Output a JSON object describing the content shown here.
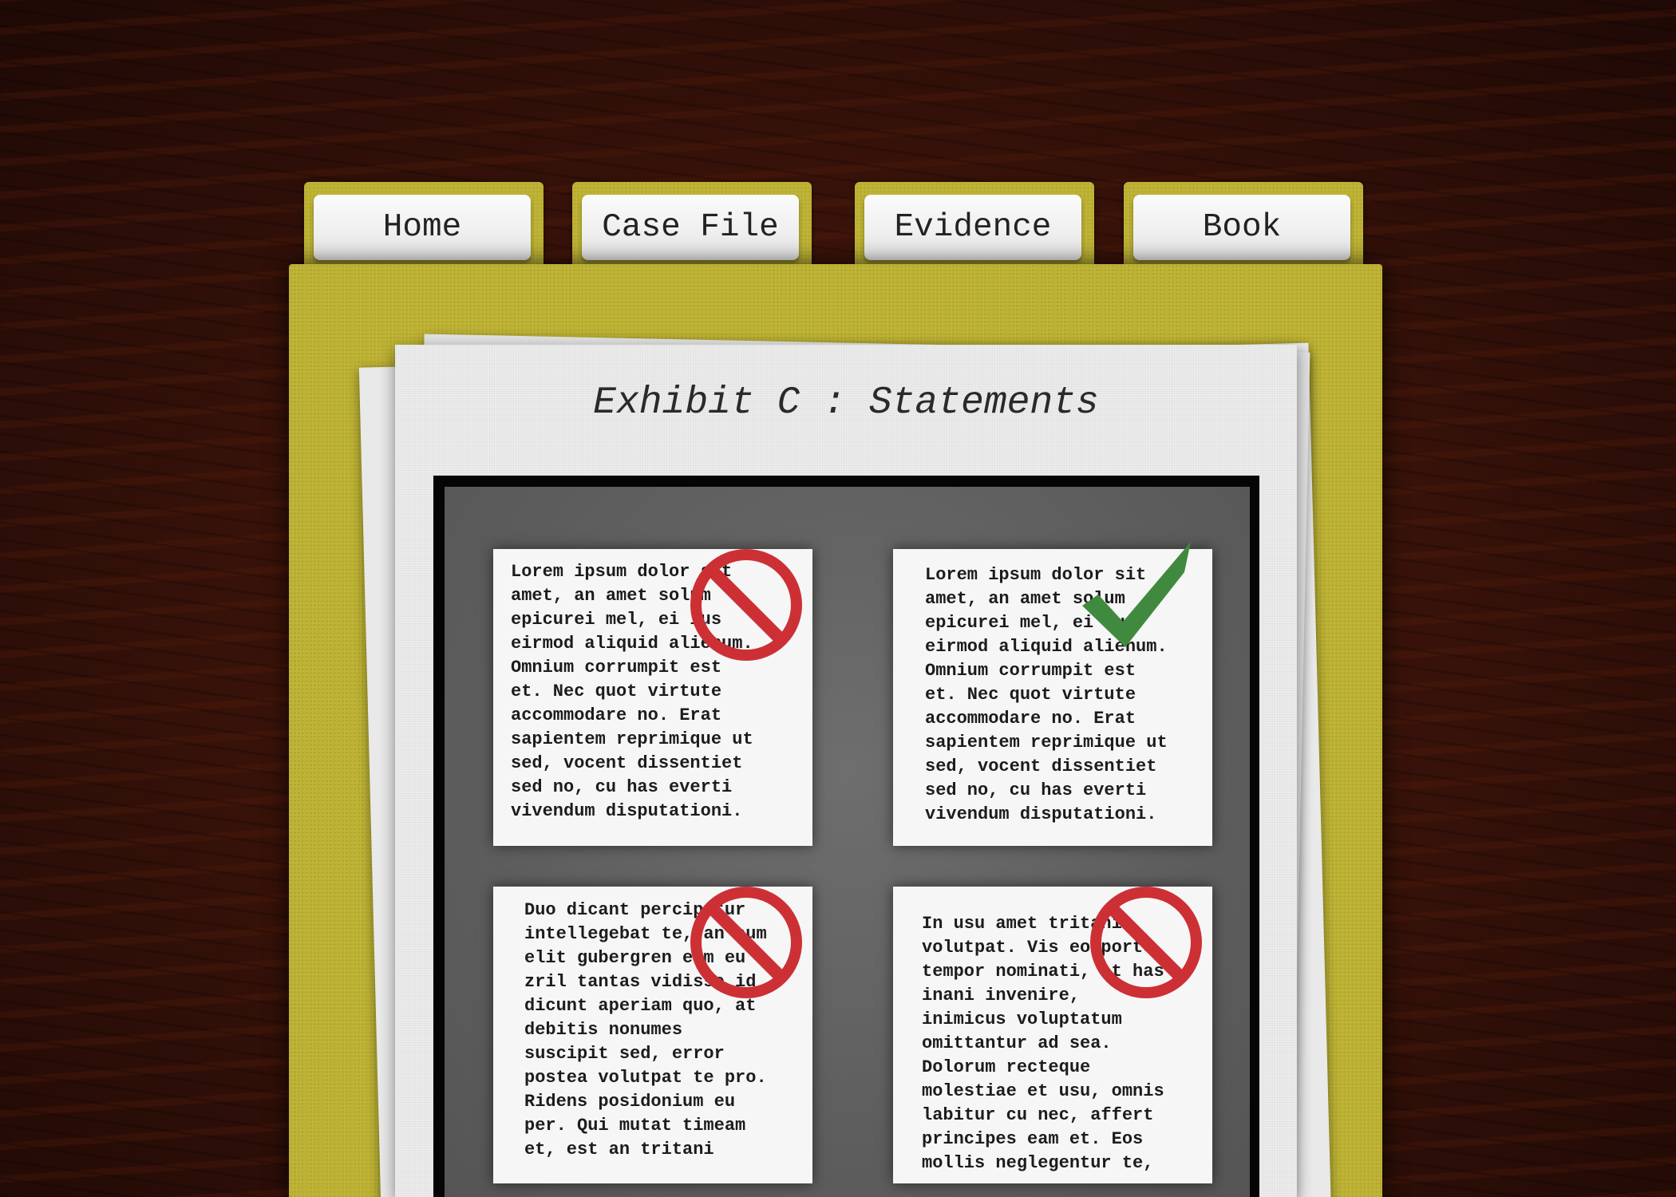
{
  "tabs": [
    {
      "label": "Home"
    },
    {
      "label": "Case File"
    },
    {
      "label": "Evidence"
    },
    {
      "label": "Book"
    }
  ],
  "page": {
    "title": "Exhibit C : Statements"
  },
  "statements": [
    {
      "text": "Lorem ipsum dolor sit\namet, an amet solum\nepicurei mel, ei ius\neirmod aliquid alienum.\nOmnium corrumpit est\net. Nec quot virtute\naccommodare no. Erat\nsapientem reprimique ut\nsed, vocent dissentiet\nsed no, cu has everti\nvivendum disputationi.",
      "status": "rejected",
      "icon": "no-entry-icon"
    },
    {
      "text": "Lorem ipsum dolor sit\namet, an amet solum\nepicurei mel, ei ius\neirmod aliquid alienum.\nOmnium corrumpit est\net. Nec quot virtute\naccommodare no. Erat\nsapientem reprimique ut\nsed, vocent dissentiet\nsed no, cu has everti\nvivendum disputationi.",
      "status": "accepted",
      "icon": "checkmark-icon"
    },
    {
      "text": "Duo dicant percipitur\nintellegebat te, an cum\nelit gubergren eum eu\nzril tantas vidisse id\ndicunt aperiam quo, at\ndebitis nonumes\nsuscipit sed, error\npostea volutpat te pro.\nRidens posidonium eu\nper. Qui mutat timeam\net, est an tritani",
      "status": "rejected",
      "icon": "no-entry-icon"
    },
    {
      "text": "In usu amet tritani\nvolutpat. Vis eo porto\ntempor nominati, at has\ninani invenire,\ninimicus voluptatum\nomittantur ad sea.\nDolorum recteque\nmolestiae et usu, omnis\nlabitur cu nec, affert\nprincipes eam et. Eos\nmollis neglegentur te,",
      "status": "rejected",
      "icon": "no-entry-icon"
    }
  ],
  "colors": {
    "folder": "#bdb232",
    "reject": "#cc3035",
    "accept": "#3f8a3f"
  }
}
